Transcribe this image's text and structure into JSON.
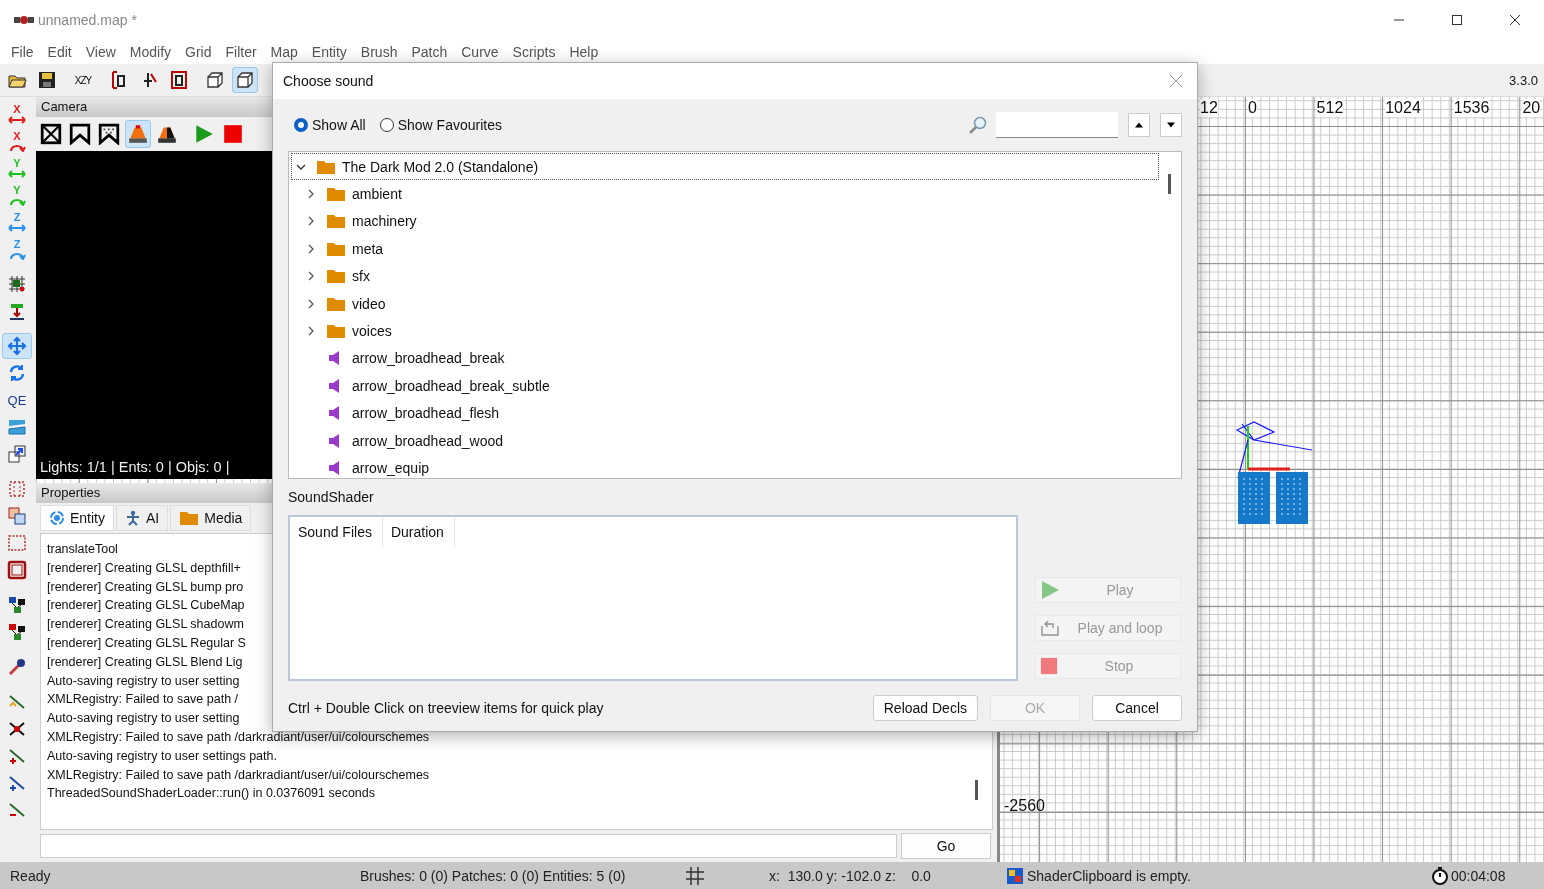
{
  "window": {
    "title": "unnamed.map *"
  },
  "menu": [
    "File",
    "Edit",
    "View",
    "Modify",
    "Grid",
    "Filter",
    "Map",
    "Entity",
    "Brush",
    "Patch",
    "Curve",
    "Scripts",
    "Help"
  ],
  "toolbar": {
    "groups": [
      [
        {
          "kind": "open",
          "selected": false
        },
        {
          "kind": "save",
          "selected": false
        }
      ],
      [
        {
          "kind": "view-axes",
          "label": "XZY",
          "selected": false
        }
      ],
      [
        {
          "kind": "brush-a",
          "selected": false
        },
        {
          "kind": "brush-b",
          "selected": false
        },
        {
          "kind": "brush-c",
          "selected": false
        }
      ],
      [
        {
          "kind": "cube",
          "selected": false
        },
        {
          "kind": "cube",
          "selected": true
        }
      ]
    ],
    "version": "3.3.0"
  },
  "left_toolbar": [
    [
      {
        "kind": "axis-move",
        "label": "X",
        "color": "#e02020",
        "selected": false
      },
      {
        "kind": "axis-rotate",
        "label": "X",
        "color": "#e02020",
        "selected": false
      },
      {
        "kind": "axis-move",
        "label": "Y",
        "color": "#20c020",
        "selected": false
      },
      {
        "kind": "axis-rotate",
        "label": "Y",
        "color": "#20c020",
        "selected": false
      },
      {
        "kind": "axis-move",
        "label": "Z",
        "color": "#2a90e8",
        "selected": false
      },
      {
        "kind": "axis-rotate",
        "label": "Z",
        "color": "#2a90e8",
        "selected": false
      }
    ],
    [
      {
        "kind": "grid-select",
        "selected": false
      },
      {
        "kind": "drop",
        "selected": false
      }
    ],
    [
      {
        "kind": "move",
        "selected": true
      },
      {
        "kind": "rotate",
        "selected": false
      },
      {
        "kind": "qe",
        "label": "QE",
        "selected": false
      },
      {
        "kind": "texture",
        "selected": false
      },
      {
        "kind": "resize",
        "selected": false
      }
    ],
    [
      {
        "kind": "select-box",
        "selected": false
      },
      {
        "kind": "clone",
        "selected": false
      },
      {
        "kind": "window-select",
        "selected": false
      },
      {
        "kind": "window-frame",
        "selected": false
      }
    ],
    [
      {
        "kind": "node-tree",
        "selected": false
      },
      {
        "kind": "node-tree-red",
        "selected": false
      }
    ],
    [
      {
        "kind": "probe",
        "selected": false
      }
    ],
    [
      {
        "kind": "curve-a",
        "selected": false
      },
      {
        "kind": "curve-b",
        "selected": false
      },
      {
        "kind": "curve-c",
        "selected": false
      },
      {
        "kind": "curve-d",
        "selected": false
      },
      {
        "kind": "curve-e",
        "selected": false
      }
    ]
  ],
  "camera": {
    "title": "Camera",
    "tools": [
      {
        "kind": "cam-wire",
        "selected": false
      },
      {
        "kind": "cam-flat",
        "selected": false
      },
      {
        "kind": "cam-checker",
        "selected": false
      },
      {
        "kind": "cam-lit",
        "selected": true
      },
      {
        "kind": "cam-lit2",
        "selected": false
      },
      {
        "kind": "play",
        "selected": false
      },
      {
        "kind": "stop",
        "selected": false
      }
    ],
    "stats": "Lights: 1/1 | Ents: 0 | Objs: 0 |"
  },
  "properties": {
    "title": "Properties",
    "tabs": [
      {
        "kind": "entity",
        "label": "Entity",
        "selected": true
      },
      {
        "kind": "ai",
        "label": "AI",
        "selected": false
      },
      {
        "kind": "media",
        "label": "Media",
        "selected": false
      }
    ],
    "console": [
      "translateTool",
      "[renderer] Creating GLSL depthfill+",
      "[renderer] Creating GLSL bump pro",
      "[renderer] Creating GLSL CubeMap",
      "[renderer] Creating GLSL shadowm",
      "[renderer] Creating GLSL Regular S",
      "[renderer] Creating GLSL Blend Lig",
      "Auto-saving registry to user setting",
      "XMLRegistry: Failed to save path /",
      "Auto-saving registry to user setting",
      "XMLRegistry: Failed to save path /darkradiant/user/ui/colourschemes",
      "Auto-saving registry to user settings path.",
      "XMLRegistry: Failed to save path /darkradiant/user/ui/colourschemes",
      "ThreadedSoundShaderLoader::run() in 0.0376091 seconds"
    ],
    "go_button": "Go"
  },
  "grid_view": {
    "ruler": [
      "12",
      "0",
      "512",
      "1024",
      "1536",
      "20"
    ],
    "side_label": "-2560"
  },
  "dialog": {
    "title": "Choose sound",
    "filters": [
      {
        "label": "Show All",
        "selected": true
      },
      {
        "label": "Show Favourites",
        "selected": false
      }
    ],
    "tree": {
      "kind": "folder",
      "label": "The Dark Mod 2.0 (Standalone)",
      "expanded": true,
      "selected": true,
      "children": [
        {
          "kind": "folder",
          "label": "ambient",
          "expanded": false,
          "selected": false
        },
        {
          "kind": "folder",
          "label": "machinery",
          "expanded": false,
          "selected": false
        },
        {
          "kind": "folder",
          "label": "meta",
          "expanded": false,
          "selected": false
        },
        {
          "kind": "folder",
          "label": "sfx",
          "expanded": false,
          "selected": false
        },
        {
          "kind": "folder",
          "label": "video",
          "expanded": false,
          "selected": false
        },
        {
          "kind": "folder",
          "label": "voices",
          "expanded": false,
          "selected": false
        },
        {
          "kind": "sound",
          "label": "arrow_broadhead_break",
          "selected": false
        },
        {
          "kind": "sound",
          "label": "arrow_broadhead_break_subtle",
          "selected": false
        },
        {
          "kind": "sound",
          "label": "arrow_broadhead_flesh",
          "selected": false
        },
        {
          "kind": "sound",
          "label": "arrow_broadhead_wood",
          "selected": false
        },
        {
          "kind": "sound",
          "label": "arrow_equip",
          "selected": false
        }
      ]
    },
    "section_label": "SoundShader",
    "columns": [
      "Sound Files",
      "Duration"
    ],
    "actions": [
      {
        "kind": "play",
        "label": "Play",
        "disabled": true
      },
      {
        "kind": "loop",
        "label": "Play and loop",
        "disabled": true
      },
      {
        "kind": "stop",
        "label": "Stop",
        "disabled": true
      }
    ],
    "hint": "Ctrl + Double Click on treeview items for quick play",
    "buttons": [
      {
        "label": "Reload Decls",
        "disabled": false
      },
      {
        "label": "OK",
        "disabled": true
      },
      {
        "label": "Cancel",
        "disabled": false
      }
    ]
  },
  "status_bar": {
    "state": "Ready",
    "counts": "Brushes: 0 (0) Patches: 0 (0) Entities: 5 (0)",
    "position": "x:  130.0 y: -102.0 z:    0.0",
    "clipboard": "ShaderClipboard is empty.",
    "timer": "00:04:08"
  }
}
